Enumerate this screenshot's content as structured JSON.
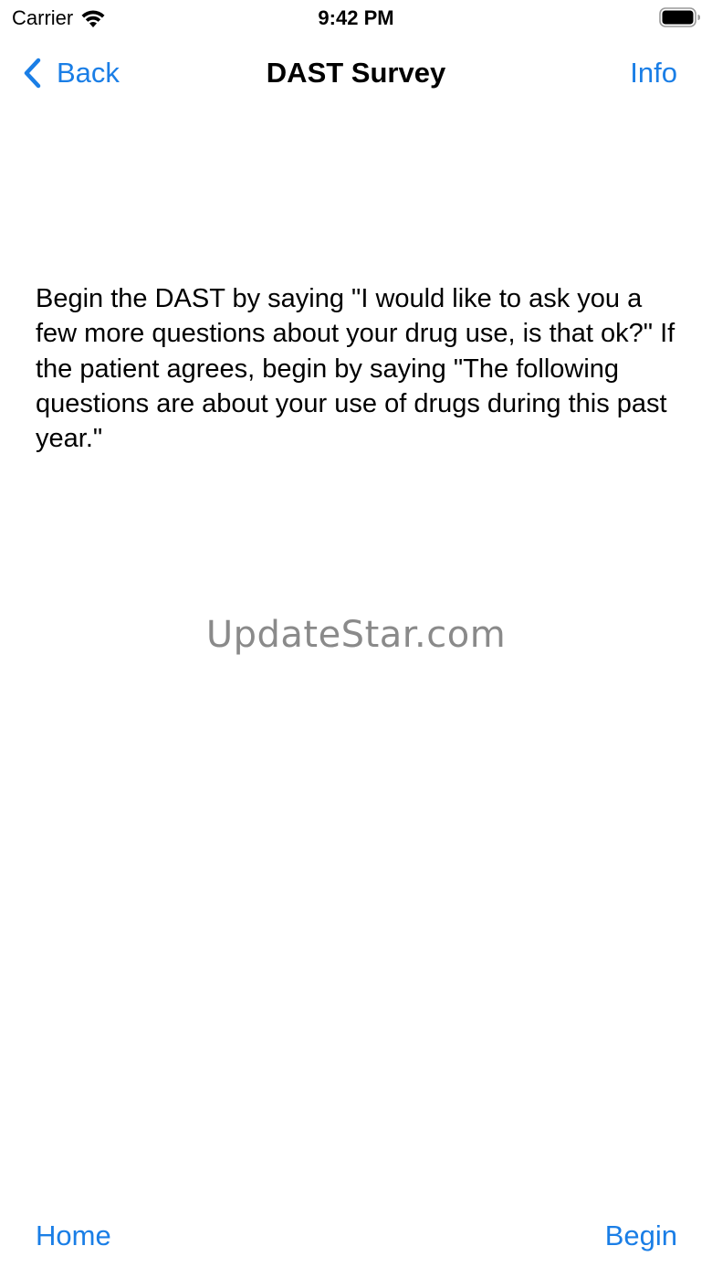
{
  "status_bar": {
    "carrier": "Carrier",
    "time": "9:42 PM",
    "icons": [
      "wifi-icon",
      "battery-icon"
    ]
  },
  "nav": {
    "back_label": "Back",
    "title": "DAST Survey",
    "info_label": "Info",
    "accent_color": "#1a7ee6"
  },
  "main": {
    "instructions": "Begin the DAST by saying \"I would like to ask you a few more questions about your drug use, is that ok?\" If the patient agrees, begin by saying \"The following questions are about your use of drugs during this past year.\""
  },
  "watermark": {
    "text": "UpdateStar.com"
  },
  "toolbar": {
    "home_label": "Home",
    "begin_label": "Begin"
  }
}
